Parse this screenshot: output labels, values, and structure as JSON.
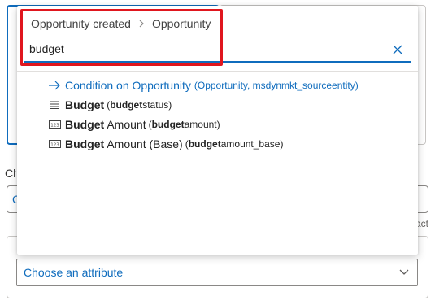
{
  "background": {
    "label_fragment": "Ch",
    "input_fragment": "C",
    "hint_fragment": "act",
    "attribute_select": {
      "label": "Choose an attribute",
      "icon": "chevron-down-icon"
    }
  },
  "flyout": {
    "breadcrumb": [
      "Opportunity created",
      "Opportunity"
    ],
    "search": {
      "value": "budget",
      "clear_icon": "close-icon"
    },
    "items": [
      {
        "type": "related-entity",
        "icon": "arrow-right-icon",
        "title": "Condition on Opportunity",
        "detail": "(Opportunity, msdynmkt_sourceentity)"
      },
      {
        "type": "option-set",
        "icon": "list-icon",
        "match": "Budget",
        "rest": "",
        "logical_open": "(",
        "logical_match": "budget",
        "logical_rest": "status)"
      },
      {
        "type": "number",
        "icon": "number-icon",
        "icon_text": "123",
        "match": "Budget",
        "rest": " Amount",
        "logical_open": "(",
        "logical_match": "budget",
        "logical_rest": "amount)"
      },
      {
        "type": "number",
        "icon": "number-icon",
        "icon_text": "123",
        "match": "Budget",
        "rest": " Amount (Base)",
        "logical_open": "(",
        "logical_match": "budget",
        "logical_rest": "amount_base)"
      }
    ]
  },
  "colors": {
    "accent": "#0f6cbd",
    "highlight": "#e0161e",
    "text": "#242424"
  }
}
